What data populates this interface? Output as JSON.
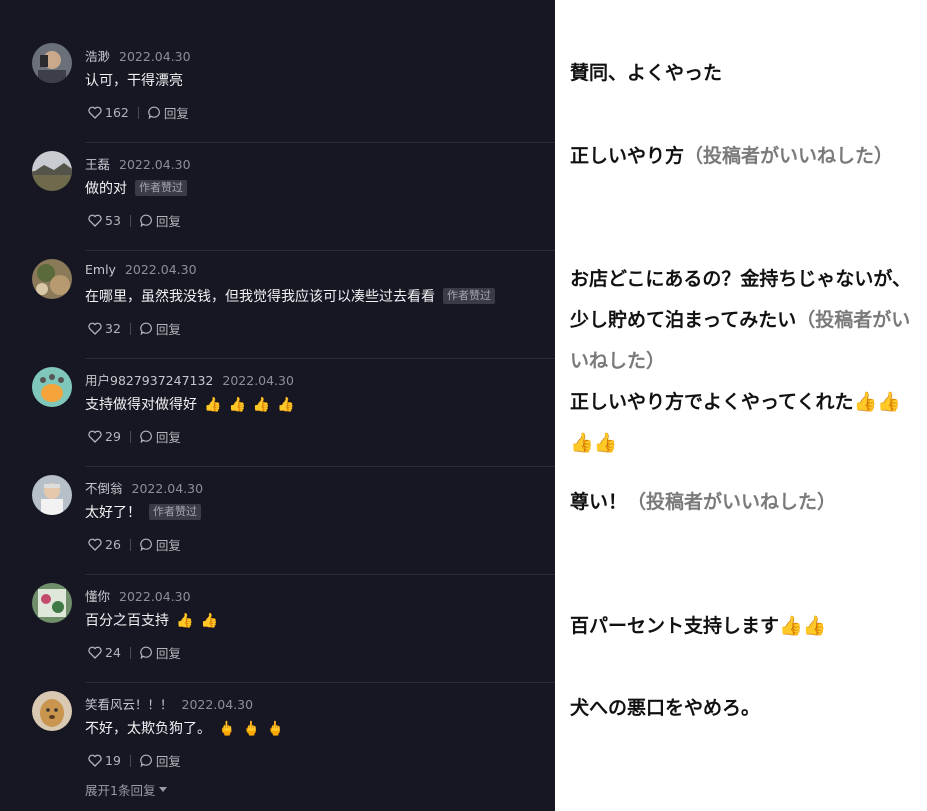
{
  "comments": [
    {
      "user": "浩渺",
      "date": "2022.04.30",
      "text": "认可，干得漂亮",
      "badge": "",
      "emojis": [],
      "likes": "162",
      "reply": "回复"
    },
    {
      "user": "王磊",
      "date": "2022.04.30",
      "text": "做的对",
      "badge": "作者赞过",
      "emojis": [],
      "likes": "53",
      "reply": "回复"
    },
    {
      "user": "Emly",
      "date": "2022.04.30",
      "text": "在哪里，虽然我没钱，但我觉得我应该可以凑些过去看看",
      "badge": "作者赞过",
      "emojis": [],
      "likes": "32",
      "reply": "回复"
    },
    {
      "user": "用户9827937247132",
      "date": "2022.04.30",
      "text": "支持做得对做得好",
      "badge": "",
      "emojis": [
        "👍",
        "👍",
        "👍",
        "👍"
      ],
      "likes": "29",
      "reply": "回复"
    },
    {
      "user": "不倒翁",
      "date": "2022.04.30",
      "text": "太好了！",
      "badge": "作者赞过",
      "emojis": [],
      "likes": "26",
      "reply": "回复"
    },
    {
      "user": "懂你",
      "date": "2022.04.30",
      "text": "百分之百支持",
      "badge": "",
      "emojis": [
        "👍",
        "👍"
      ],
      "likes": "24",
      "reply": "回复"
    },
    {
      "user": "笑看风云！！！",
      "date": "2022.04.30",
      "text": "不好，太欺负狗了。",
      "badge": "",
      "emojis": [
        "🖕",
        "🖕",
        "🖕"
      ],
      "likes": "19",
      "reply": "回复"
    }
  ],
  "expand_label": "展开1条回复",
  "translations": [
    {
      "text": "賛同、よくやった",
      "note": ""
    },
    {
      "text": "正しいやり方",
      "note": "（投稿者がいいねした）"
    },
    {
      "text": "お店どこにあるの？金持ちじゃないが、少し貯めて泊まってみたい",
      "note": "（投稿者がいいねした）"
    },
    {
      "text": "正しいやり方でよくやってくれた👍👍👍👍",
      "note": ""
    },
    {
      "text": "尊い！",
      "note": "（投稿者がいいねした）"
    },
    {
      "text": "百パーセント支持します👍👍",
      "note": ""
    },
    {
      "text": "犬への悪口をやめろ。",
      "note": ""
    }
  ],
  "colors": {
    "panel_bg": "#161722",
    "page_bg": "#ffffff",
    "note_gray": "#7a7a7a",
    "badge_bg": "#3a3b46"
  }
}
